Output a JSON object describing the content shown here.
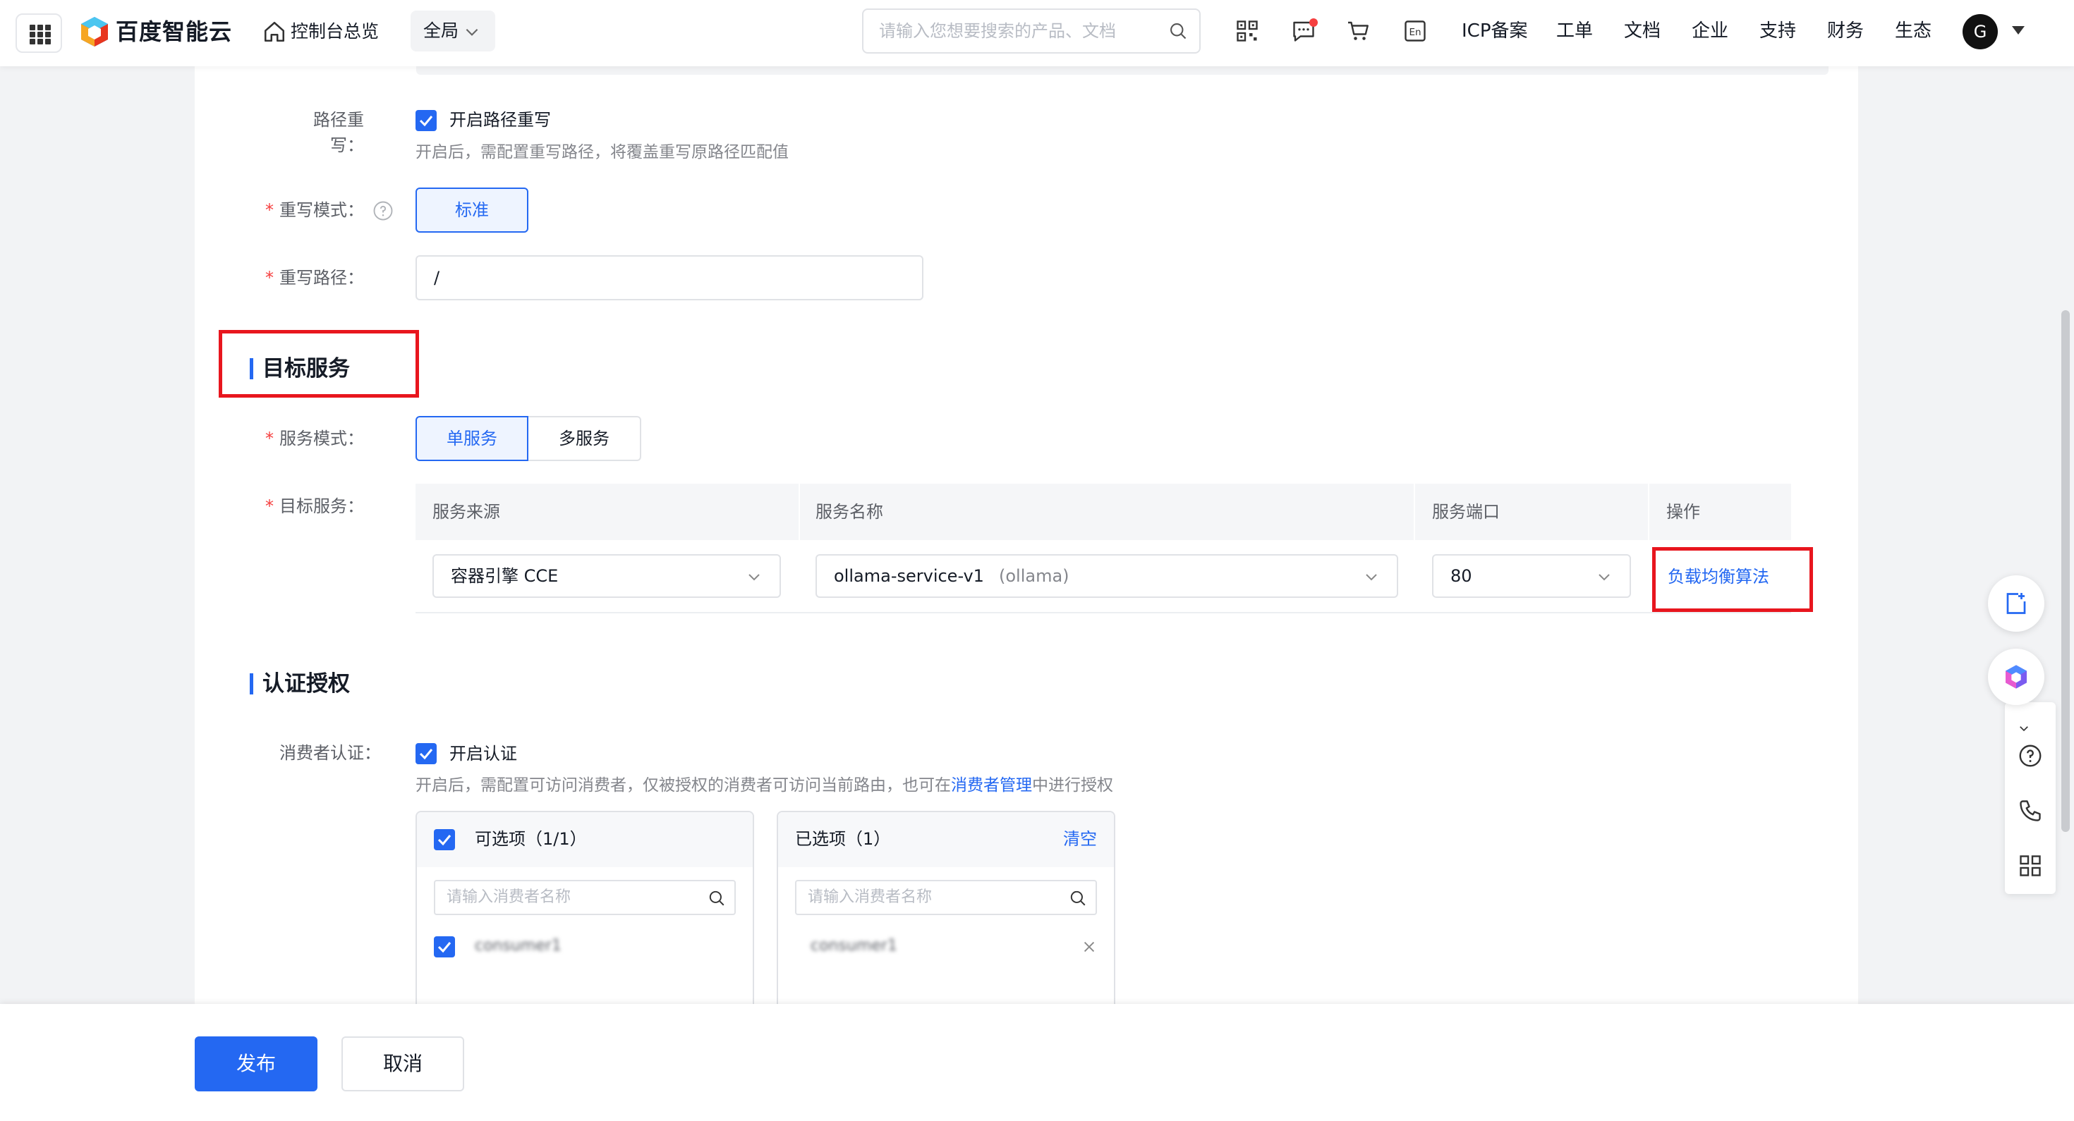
{
  "header": {
    "logo_text": "百度智能云",
    "console_link": "控制台总览",
    "scope": "全局",
    "search_placeholder": "请输入您想要搜索的产品、文档",
    "icons": [
      "qrcode-icon",
      "message-icon",
      "cart-icon",
      "language-en-icon"
    ],
    "language_icon_text": "En",
    "nav_links": [
      "ICP备案",
      "工单",
      "文档",
      "企业",
      "支持",
      "财务",
      "生态"
    ],
    "avatar_letter": "G"
  },
  "rewrite": {
    "path_rewrite_label": "路径重写：",
    "enable_label": "开启路径重写",
    "enable_checked": true,
    "enable_hint": "开启后，需配置重写路径，将覆盖重写原路径匹配值",
    "mode_label": "重写模式：",
    "mode_value": "标准",
    "path_label": "重写路径：",
    "path_value": "/"
  },
  "target_service": {
    "section_title": "目标服务",
    "mode_label": "服务模式：",
    "modes": [
      "单服务",
      "多服务"
    ],
    "selected_mode": "单服务",
    "service_label": "目标服务：",
    "columns": [
      "服务来源",
      "服务名称",
      "服务端口",
      "操作"
    ],
    "row": {
      "source": "容器引擎 CCE",
      "name": "ollama-service-v1",
      "name_suffix": "(ollama)",
      "port": "80",
      "action": "负载均衡算法"
    }
  },
  "auth": {
    "section_title": "认证授权",
    "consumer_label": "消费者认证：",
    "enable_label": "开启认证",
    "enable_checked": true,
    "hint_before": "开启后，需配置可访问消费者，仅被授权的消费者可访问当前路由，也可在",
    "hint_link": "消费者管理",
    "hint_after": "中进行授权",
    "available": {
      "title": "可选项（1/1）",
      "search_placeholder": "请输入消费者名称",
      "items": [
        "consumer1"
      ]
    },
    "selected": {
      "title": "已选项（1）",
      "clear": "清空",
      "search_placeholder": "请输入消费者名称",
      "items": [
        "consumer1"
      ]
    }
  },
  "footer": {
    "publish": "发布",
    "cancel": "取消"
  },
  "colors": {
    "primary": "#2468f2",
    "annotation_red": "#e8161e",
    "required_star": "#f53f3f"
  }
}
